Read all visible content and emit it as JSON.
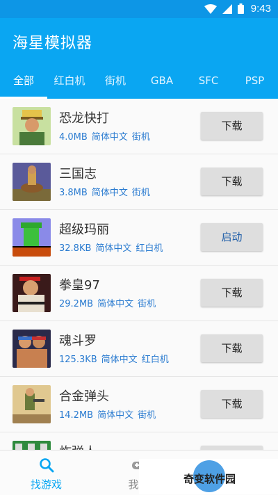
{
  "status": {
    "time": "9:43"
  },
  "app": {
    "title": "海星模拟器"
  },
  "tabs": [
    "全部",
    "红白机",
    "街机",
    "GBA",
    "SFC",
    "PSP"
  ],
  "games": [
    {
      "name": "恐龙快打",
      "size": "4.0MB",
      "lang": "简体中文",
      "platform": "街机",
      "action": "下载"
    },
    {
      "name": "三国志",
      "size": "3.8MB",
      "lang": "简体中文",
      "platform": "街机",
      "action": "下载"
    },
    {
      "name": "超级玛丽",
      "size": "32.8KB",
      "lang": "简体中文",
      "platform": "红白机",
      "action": "启动"
    },
    {
      "name": "拳皇97",
      "size": "29.2MB",
      "lang": "简体中文",
      "platform": "街机",
      "action": "下载"
    },
    {
      "name": "魂斗罗",
      "size": "125.3KB",
      "lang": "简体中文",
      "platform": "红白机",
      "action": "下载"
    },
    {
      "name": "合金弹头",
      "size": "14.2MB",
      "lang": "简体中文",
      "platform": "街机",
      "action": "下载"
    },
    {
      "name": "炸弹人",
      "size": "",
      "lang": "",
      "platform": "",
      "action": ""
    }
  ],
  "bottom_nav": {
    "find_games": "找游戏",
    "my_games": "我的"
  },
  "watermark": {
    "text": "奇变软件园"
  },
  "colors": {
    "statusbar": "#0d96e6",
    "appbar": "#0aa6f2",
    "accent": "#0aa6f2"
  }
}
